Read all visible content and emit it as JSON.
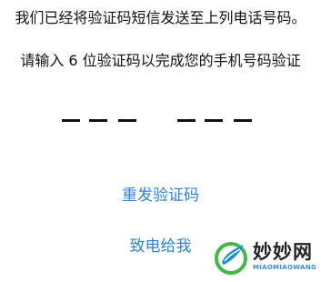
{
  "message": {
    "line1": "我们已经将验证码短信发送至上列电话号码。",
    "line2": "请输入 6 位验证码以完成您的手机号码验证"
  },
  "code": {
    "length": 6,
    "entered": ""
  },
  "actions": {
    "resend_label": "重发验证码",
    "call_label": "致电给我"
  },
  "watermark": {
    "title": "妙妙网",
    "subtitle": "MIAOMIAOWANG"
  },
  "colors": {
    "link": "#2b84d8",
    "text": "#111111",
    "background": "#ffffff"
  }
}
